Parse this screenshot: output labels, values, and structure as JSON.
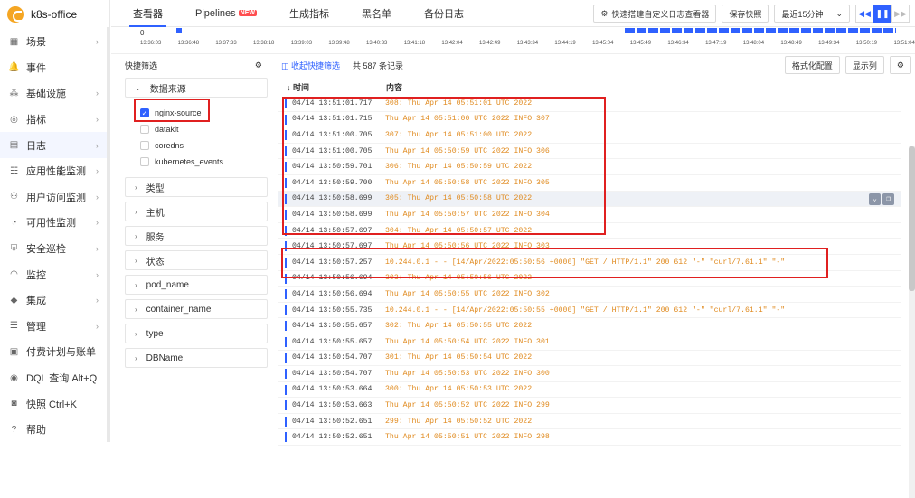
{
  "app": {
    "name": "k8s-office"
  },
  "sidebar": {
    "items": [
      {
        "label": "场景",
        "icon": "scene-icon",
        "arrow": true
      },
      {
        "label": "事件",
        "icon": "bell-icon",
        "arrow": false
      },
      {
        "label": "基础设施",
        "icon": "infrastructure-icon",
        "arrow": true
      },
      {
        "label": "指标",
        "icon": "metrics-icon",
        "arrow": true
      },
      {
        "label": "日志",
        "icon": "log-icon",
        "arrow": true,
        "active": true
      },
      {
        "label": "应用性能监测",
        "icon": "apm-icon",
        "arrow": true
      },
      {
        "label": "用户访问监测",
        "icon": "rum-icon",
        "arrow": true
      },
      {
        "label": "可用性监测",
        "icon": "dial-icon",
        "arrow": true
      },
      {
        "label": "安全巡检",
        "icon": "shield-icon",
        "arrow": true
      },
      {
        "label": "监控",
        "icon": "monitor-icon",
        "arrow": true
      },
      {
        "label": "集成",
        "icon": "integration-icon",
        "arrow": true
      },
      {
        "label": "管理",
        "icon": "manage-icon",
        "arrow": true
      },
      {
        "label": "付费计划与账单",
        "icon": "billing-icon",
        "arrow": false
      },
      {
        "label": "DQL 查询  Alt+Q",
        "icon": "query-icon",
        "arrow": false
      },
      {
        "label": "快照  Ctrl+K",
        "icon": "camera-icon",
        "arrow": false
      },
      {
        "label": "帮助",
        "icon": "help-icon",
        "arrow": false
      }
    ]
  },
  "tabs": [
    {
      "label": "查看器",
      "active": true
    },
    {
      "label": "Pipelines",
      "badge": "NEW"
    },
    {
      "label": "生成指标"
    },
    {
      "label": "黑名单"
    },
    {
      "label": "备份日志"
    }
  ],
  "toolbar": {
    "custom_viewer": "快速搭建自定义日志查看器",
    "save_snapshot": "保存快照",
    "time_range": "最近15分钟"
  },
  "timeline": {
    "zero": "0",
    "ticks": [
      "13:36:03",
      "13:36:48",
      "13:37:33",
      "13:38:18",
      "13:39:03",
      "13:39:48",
      "13:40:33",
      "13:41:18",
      "13:42:04",
      "13:42:49",
      "13:43:34",
      "13:44:19",
      "13:45:04",
      "13:45:49",
      "13:46:34",
      "13:47:19",
      "13:48:04",
      "13:48:49",
      "13:49:34",
      "13:50:19",
      "13:51:04"
    ]
  },
  "quick_filter": {
    "title": "快捷筛选",
    "data_source_label": "数据来源",
    "sources": [
      {
        "name": "nginx-source",
        "checked": true
      },
      {
        "name": "datakit",
        "checked": false
      },
      {
        "name": "coredns",
        "checked": false
      },
      {
        "name": "kubernetes_events",
        "checked": false
      }
    ],
    "groups": [
      "类型",
      "主机",
      "服务",
      "状态",
      "pod_name",
      "container_name",
      "type",
      "DBName"
    ]
  },
  "main": {
    "collapse_label": "收起快捷筛选",
    "total": "共 587 条记录",
    "format_btn": "格式化配置",
    "columns_btn": "显示列",
    "col_time": "时间",
    "col_content": "内容"
  },
  "rows": [
    {
      "time": "04/14 13:51:01.717",
      "content": "308: Thu Apr 14 05:51:01 UTC 2022"
    },
    {
      "time": "04/14 13:51:01.715",
      "content": "Thu Apr 14 05:51:00 UTC 2022 INFO 307"
    },
    {
      "time": "04/14 13:51:00.705",
      "content": "307: Thu Apr 14 05:51:00 UTC 2022"
    },
    {
      "time": "04/14 13:51:00.705",
      "content": "Thu Apr 14 05:50:59 UTC 2022 INFO 306"
    },
    {
      "time": "04/14 13:50:59.701",
      "content": "306: Thu Apr 14 05:50:59 UTC 2022"
    },
    {
      "time": "04/14 13:50:59.700",
      "content": "Thu Apr 14 05:50:58 UTC 2022 INFO 305"
    },
    {
      "time": "04/14 13:50:58.699",
      "content": "305: Thu Apr 14 05:50:58 UTC 2022"
    },
    {
      "time": "04/14 13:50:58.699",
      "content": "Thu Apr 14 05:50:57 UTC 2022 INFO 304"
    },
    {
      "time": "04/14 13:50:57.697",
      "content": "304: Thu Apr 14 05:50:57 UTC 2022"
    },
    {
      "time": "04/14 13:50:57.697",
      "content": "Thu Apr 14 05:50:56 UTC 2022 INFO 303"
    },
    {
      "time": "04/14 13:50:57.257",
      "content": "10.244.0.1 - - [14/Apr/2022:05:50:56 +0000] \"GET / HTTP/1.1\" 200 612 \"-\" \"curl/7.61.1\" \"-\""
    },
    {
      "time": "04/14 13:50:56.694",
      "content": "303: Thu Apr 14 05:50:56 UTC 2022"
    },
    {
      "time": "04/14 13:50:56.694",
      "content": "Thu Apr 14 05:50:55 UTC 2022 INFO 302"
    },
    {
      "time": "04/14 13:50:55.735",
      "content": "10.244.0.1 - - [14/Apr/2022:05:50:55 +0000] \"GET / HTTP/1.1\" 200 612 \"-\" \"curl/7.61.1\" \"-\""
    },
    {
      "time": "04/14 13:50:55.657",
      "content": "302: Thu Apr 14 05:50:55 UTC 2022"
    },
    {
      "time": "04/14 13:50:55.657",
      "content": "Thu Apr 14 05:50:54 UTC 2022 INFO 301"
    },
    {
      "time": "04/14 13:50:54.707",
      "content": "301: Thu Apr 14 05:50:54 UTC 2022"
    },
    {
      "time": "04/14 13:50:54.707",
      "content": "Thu Apr 14 05:50:53 UTC 2022 INFO 300"
    },
    {
      "time": "04/14 13:50:53.664",
      "content": "300: Thu Apr 14 05:50:53 UTC 2022"
    },
    {
      "time": "04/14 13:50:53.663",
      "content": "Thu Apr 14 05:50:52 UTC 2022 INFO 299"
    },
    {
      "time": "04/14 13:50:52.651",
      "content": "299: Thu Apr 14 05:50:52 UTC 2022"
    },
    {
      "time": "04/14 13:50:52.651",
      "content": "Thu Apr 14 05:50:51 UTC 2022 INFO 298"
    }
  ],
  "colors": {
    "accent": "#2f61ff",
    "highlight": "#e02020",
    "log_text": "#e08a1e"
  }
}
